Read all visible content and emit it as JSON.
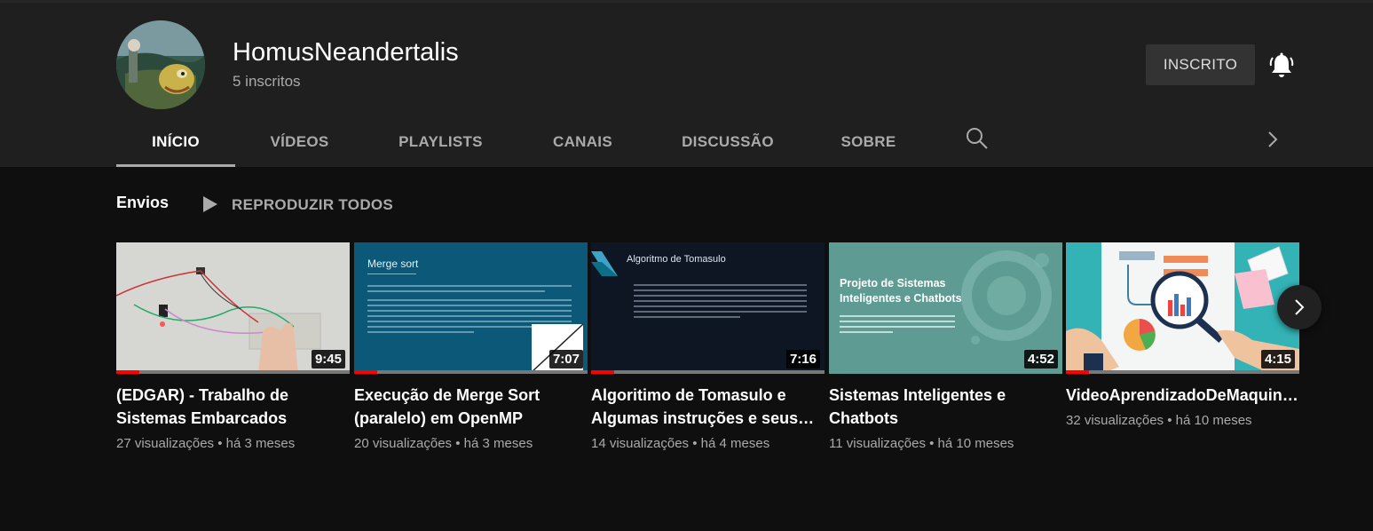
{
  "channel": {
    "name": "HomusNeandertalis",
    "subscribers": "5 inscritos",
    "subscribe_label": "INSCRITO",
    "avatar_icon": "avatar-image",
    "bell_icon": "notification-bell-icon"
  },
  "tabs": [
    {
      "label": "INÍCIO",
      "active": true
    },
    {
      "label": "VÍDEOS",
      "active": false
    },
    {
      "label": "PLAYLISTS",
      "active": false
    },
    {
      "label": "CANAIS",
      "active": false
    },
    {
      "label": "DISCUSSÃO",
      "active": false
    },
    {
      "label": "SOBRE",
      "active": false
    }
  ],
  "shelf": {
    "title": "Envios",
    "play_all_label": "REPRODUZIR TODOS",
    "videos": [
      {
        "title": "(EDGAR) - Trabalho de Sistemas Embarcados",
        "duration": "9:45",
        "meta": "27 visualizações • há 3 meses",
        "watched_fraction": 0.1
      },
      {
        "title": "Execução de Merge Sort (paralelo) em OpenMP",
        "duration": "7:07",
        "meta": "20 visualizações • há 3 meses",
        "watched_fraction": 0.1,
        "thumb_heading": "Merge sort",
        "thumb_text": "O merge sort, ou ordenação por mistura, é um exemplo de algoritmo de ordenação por comparação do tipo dividir-para-conquistar."
      },
      {
        "title": "Algoritimo de Tomasulo e Algumas instruções e seus resultados",
        "duration": "7:16",
        "meta": "14 visualizações • há 4 meses",
        "watched_fraction": 0.1,
        "thumb_heading": "Algoritmo de Tomasulo",
        "thumb_text": "Em arquitetura de computadores, o Algoritmo de Tomasulo é um algoritmo de hardware para distribuição dinâmica de tarefas."
      },
      {
        "title": "Sistemas Inteligentes e Chatbots",
        "duration": "4:52",
        "meta": "11 visualizações • há 10 meses",
        "watched_fraction": 0,
        "thumb_heading_1": "Projeto de Sistemas",
        "thumb_heading_2": "Inteligentes e Chatbots",
        "thumb_text": "Alunos(as): Giovanna B. Barbosa, Igor Pinheiro de P. Alvarenga, Italo G. Carvalho, Leonardo Augusto de S. Filho"
      },
      {
        "title": "VideoAprendizadoDeMaquinaSI",
        "duration": "4:15",
        "meta": "32 visualizações • há 10 meses",
        "watched_fraction": 0.1
      }
    ]
  },
  "colors": {
    "header_bg": "#1f1f1f",
    "page_bg": "#0f0f0f",
    "progress_red": "#ff0000",
    "subscribe_bg": "#333333"
  }
}
